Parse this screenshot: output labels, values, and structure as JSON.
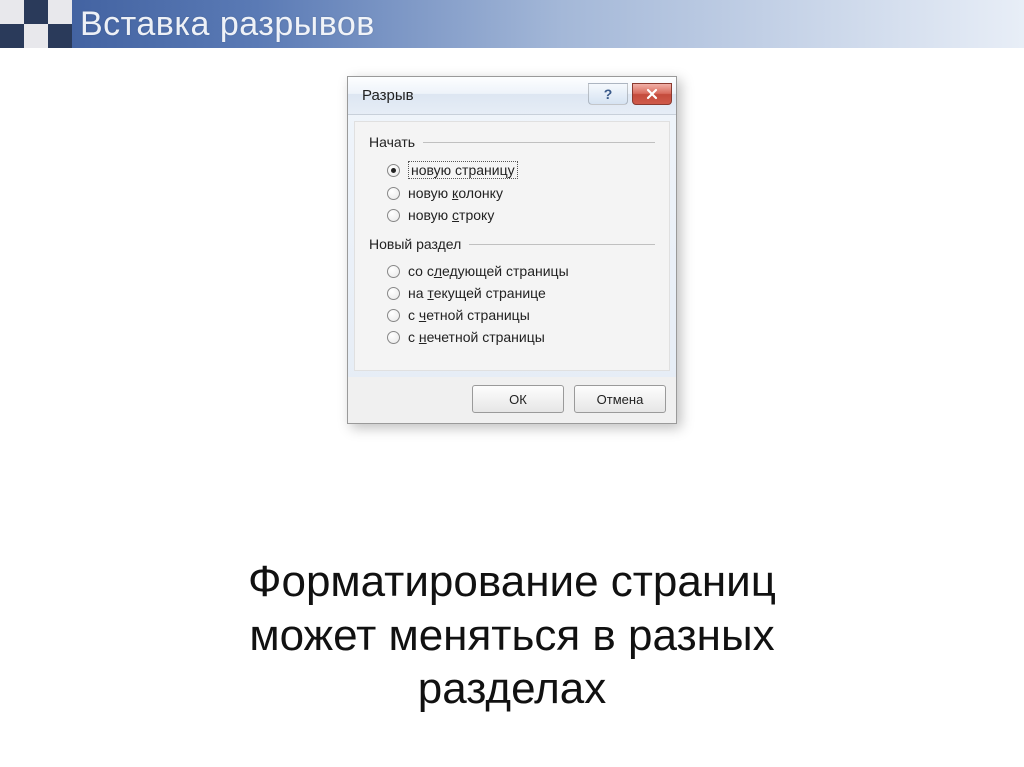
{
  "header": {
    "title": "Вставка разрывов"
  },
  "dialog": {
    "title": "Разрыв",
    "group1": {
      "legend": "Начать",
      "options": [
        {
          "label": "новую страницу",
          "selected": true,
          "focused": true,
          "accel": ""
        },
        {
          "label_pre": "новую ",
          "accel": "к",
          "label_post": "олонку",
          "selected": false
        },
        {
          "label_pre": "новую ",
          "accel": "с",
          "label_post": "троку",
          "selected": false
        }
      ]
    },
    "group2": {
      "legend": "Новый раздел",
      "options": [
        {
          "label_pre": "со с",
          "accel": "л",
          "label_post": "едующей страницы",
          "selected": false
        },
        {
          "label_pre": "на ",
          "accel": "т",
          "label_post": "екущей странице",
          "selected": false
        },
        {
          "label_pre": "с ",
          "accel": "ч",
          "label_post": "етной страницы",
          "selected": false
        },
        {
          "label_pre": "с ",
          "accel": "н",
          "label_post": "ечетной страницы",
          "selected": false
        }
      ]
    },
    "buttons": {
      "ok": "ОК",
      "cancel": "Отмена"
    }
  },
  "caption": {
    "line1": "Форматирование страниц",
    "line2": "может меняться в разных",
    "line3": "разделах"
  }
}
